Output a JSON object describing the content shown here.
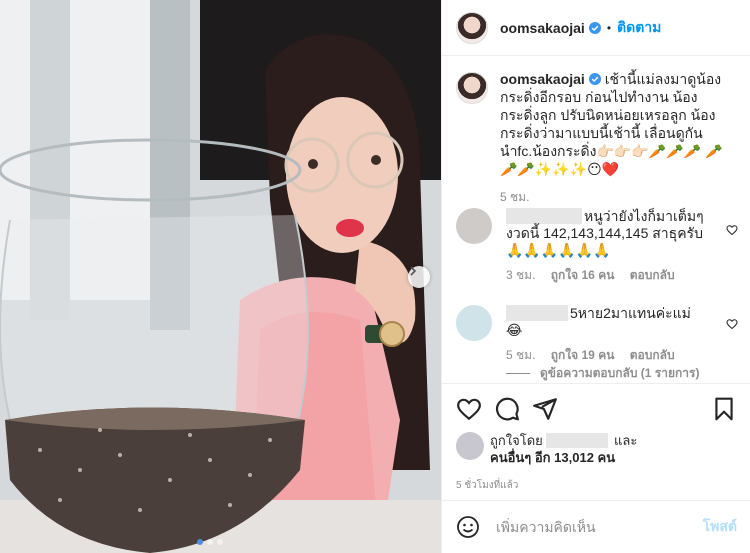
{
  "post": {
    "username": "oomsakaojai",
    "follow_label": "ติดตาม",
    "separator": "•",
    "caption": "เช้านี้แม่ลงมาดูน้องกระดิ่งอีกรอบ ก่อนไปทำงาน น้องกระดิ่งลูก ปรับนิดหน่อยเหรอลูก น้องกระดิ่งว่ามาแบบนี้เช้านี้ เลื่อนดูกันนำfc.น้องกระดิ่ง👉🏻👉🏻👉🏻🥕🥕🥕 🥕🥕🥕✨✨✨😶❤️",
    "caption_time": "5 ชม."
  },
  "comments": [
    {
      "text": "หนูว่ายังไงก็มาเต็มๆ งวดนี้ 142,143,144,145 สาธุครับ 🙏🙏🙏🙏🙏🙏",
      "time": "3 ชม.",
      "likes": "ถูกใจ 16 คน",
      "reply": "ตอบกลับ",
      "avatar_color": "#cfcbc9"
    },
    {
      "text": "5หาย2มาแทนค่ะแม่😂",
      "time": "5 ชม.",
      "likes": "ถูกใจ 19 คน",
      "reply": "ตอบกลับ",
      "avatar_color": "#cfe3e8"
    }
  ],
  "view_replies": "ดูข้อความตอบกลับ (1 รายการ)",
  "likes": {
    "prefix": "ถูกใจโดย",
    "and": "และ",
    "others": "คนอื่นๆ อีก 13,012 คน"
  },
  "posted_ago": "5 ชั่วโมงที่แล้ว",
  "add_comment": {
    "placeholder": "เพิ่มความคิดเห็น",
    "post_label": "โพสต์"
  },
  "icons": {
    "like": "heart-icon",
    "comment": "comment-icon",
    "share": "share-icon",
    "save": "bookmark-icon",
    "emoji": "emoji-icon",
    "verified": "verified-badge-icon",
    "next": "chevron-right-icon"
  },
  "colors": {
    "link_blue": "#0095f6",
    "verified_blue": "#3897f0",
    "muted": "#8e8e8e",
    "post_disabled": "#b2dffc"
  },
  "carousel": {
    "slides": 3,
    "active": 0
  }
}
